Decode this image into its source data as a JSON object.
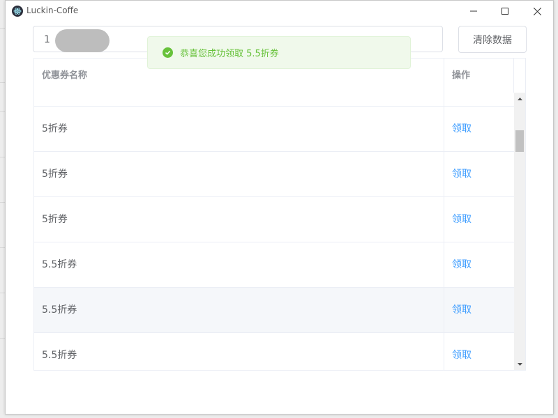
{
  "window": {
    "title": "Luckin-Coffe"
  },
  "search": {
    "value": "1"
  },
  "toolbar": {
    "clear_label": "清除数据"
  },
  "table": {
    "headers": {
      "name": "优惠券名称",
      "action": "操作"
    },
    "rows": [
      {
        "name": "",
        "action": ""
      },
      {
        "name": "5折券",
        "action": "领取"
      },
      {
        "name": "5折券",
        "action": "领取"
      },
      {
        "name": "5折券",
        "action": "领取"
      },
      {
        "name": "5.5折券",
        "action": "领取"
      },
      {
        "name": "5.5折券",
        "action": "领取"
      },
      {
        "name": "5.5折券",
        "action": "领取"
      }
    ]
  },
  "toast": {
    "message": "恭喜您成功领取 5.5折券",
    "type": "success"
  },
  "colors": {
    "link": "#409eff",
    "success": "#67c23a",
    "success_bg": "#f0f9eb"
  }
}
